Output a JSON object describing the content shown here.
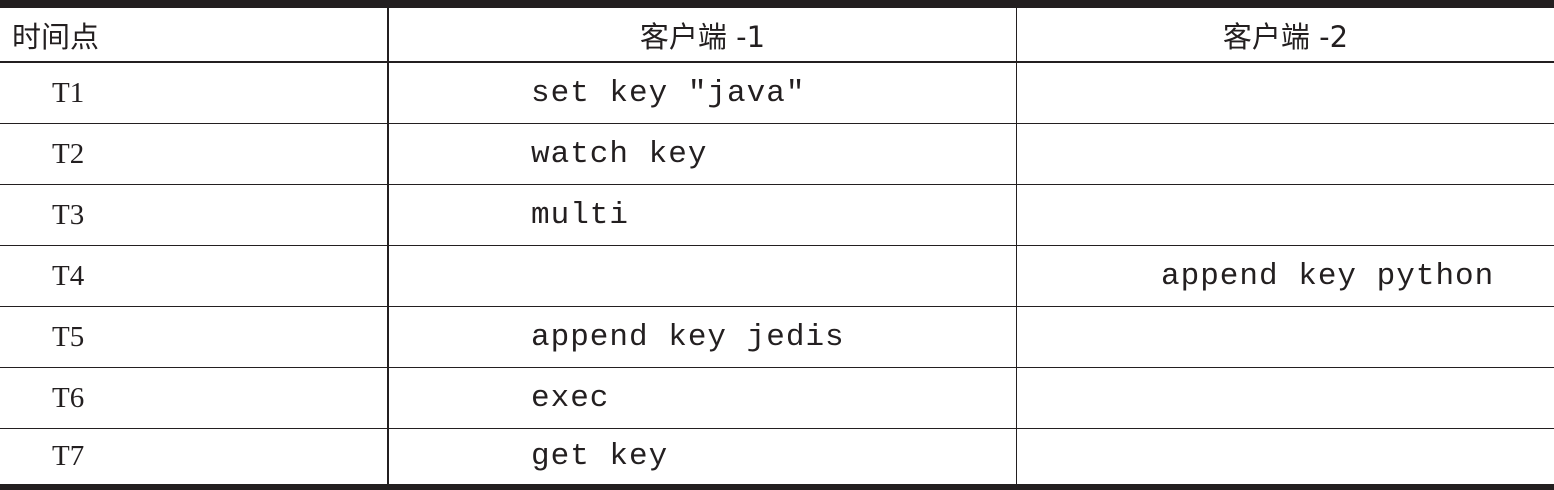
{
  "table": {
    "headers": {
      "time": "时间点",
      "client1": "客户端 -1",
      "client2": "客户端 -2"
    },
    "rows": [
      {
        "time": "T1",
        "client1": "set key \"java\"",
        "client2": ""
      },
      {
        "time": "T2",
        "client1": "watch key",
        "client2": ""
      },
      {
        "time": "T3",
        "client1": "multi",
        "client2": ""
      },
      {
        "time": "T4",
        "client1": "",
        "client2": "append key python"
      },
      {
        "time": "T5",
        "client1": "append key jedis",
        "client2": ""
      },
      {
        "time": "T6",
        "client1": "exec",
        "client2": ""
      },
      {
        "time": "T7",
        "client1": "get key",
        "client2": ""
      }
    ]
  }
}
